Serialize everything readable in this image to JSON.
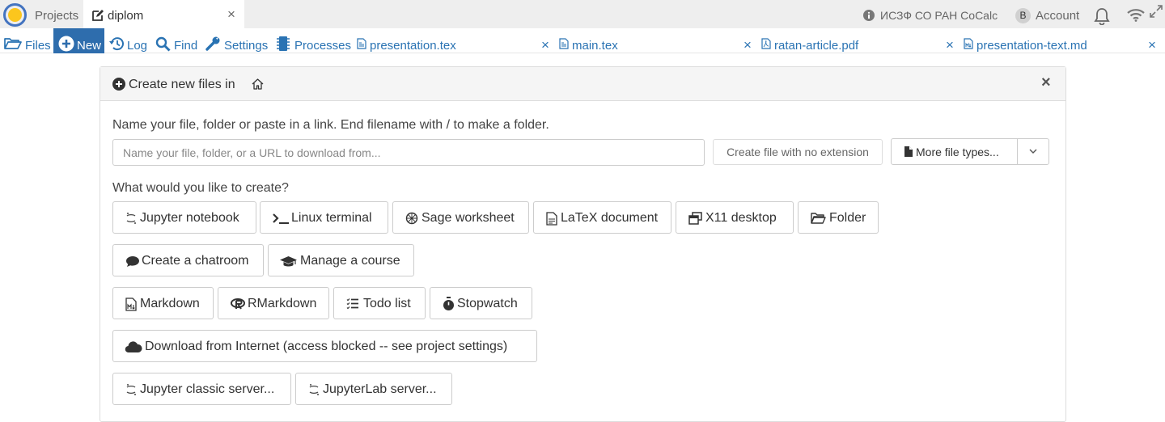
{
  "topbar": {
    "projects_label": "Projects",
    "project_tab_label": "diplom",
    "close_glyph": "×",
    "site_name": "ИСЗФ СО РАН CoCalc",
    "account_initial": "B",
    "account_label": "Account",
    "icons": [
      "cocalc-logo-icon",
      "edit-icon",
      "info-icon",
      "bell-icon",
      "wifi-icon",
      "expand-icon"
    ]
  },
  "actionbar": {
    "files": "Files",
    "new": "New",
    "log": "Log",
    "find": "Find",
    "settings": "Settings",
    "processes": "Processes",
    "open_files": [
      {
        "name": "presentation.tex",
        "close": "×"
      },
      {
        "name": "main.tex",
        "close": "×"
      },
      {
        "name": "ratan-article.pdf",
        "close": "×"
      },
      {
        "name": "presentation-text.md",
        "close": "×"
      }
    ],
    "link_color": "#2a73b3",
    "active_bg": "#2e6dad"
  },
  "panel": {
    "title": "Create new files in",
    "close_glyph": "×",
    "hint": "Name your file, folder or paste in a link. End filename with / to make a folder.",
    "input_placeholder": "Name your file, folder, or a URL to download from...",
    "input_value": "",
    "no_extension_button": "Create file with no extension",
    "more_types_button": "More file types...",
    "question": "What would you like to create?",
    "buttons": {
      "jupyter": "Jupyter notebook",
      "terminal": "Linux terminal",
      "sage": "Sage worksheet",
      "latex": "LaTeX document",
      "x11": "X11 desktop",
      "folder": "Folder",
      "chatroom": "Create a chatroom",
      "course": "Manage a course",
      "markdown": "Markdown",
      "rmarkdown": "RMarkdown",
      "todo": "Todo list",
      "stopwatch": "Stopwatch",
      "download": "Download from Internet (access blocked -- see project settings)",
      "jupyter_classic": "Jupyter classic server...",
      "jupyterlab": "JupyterLab server..."
    }
  }
}
